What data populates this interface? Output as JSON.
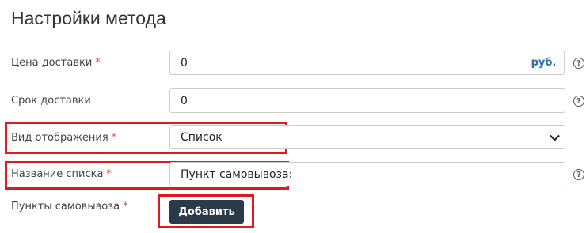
{
  "page": {
    "title": "Настройки метода"
  },
  "fields": {
    "delivery_price": {
      "label": "Цена доставки",
      "required": "*",
      "value": "0",
      "addon": "руб."
    },
    "delivery_time": {
      "label": "Срок доставки",
      "value": "0"
    },
    "display_type": {
      "label": "Вид отображения",
      "required": "*",
      "value": "Список"
    },
    "list_name": {
      "label": "Название списка",
      "required": "*",
      "value": "Пункт самовывоза:"
    },
    "pickup_points": {
      "label": "Пункты самовывоза",
      "required": "*",
      "button": "Добавить"
    }
  },
  "icons": {
    "help": "?"
  },
  "colors": {
    "required": "#d9534f",
    "highlight": "#e0191e",
    "button_bg": "#2b3a48",
    "addon_text": "#2a6eb5"
  }
}
